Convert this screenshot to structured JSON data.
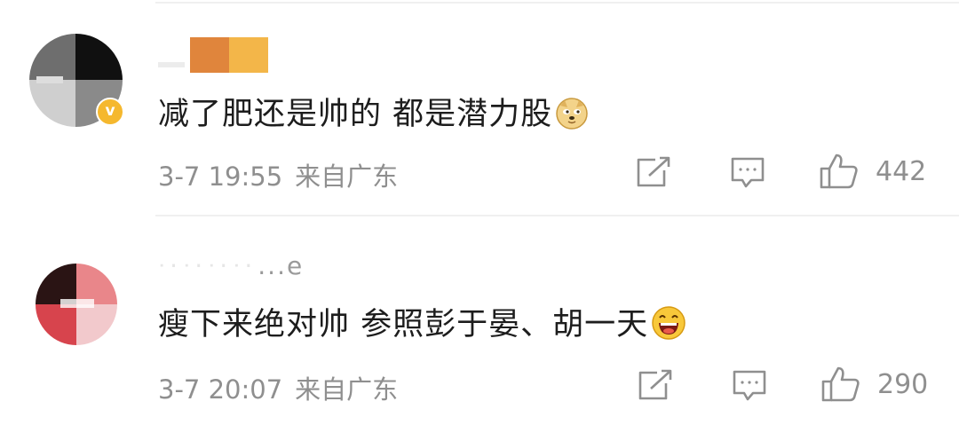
{
  "comments": [
    {
      "username": "",
      "text": "减了肥还是帅的 都是潜力股",
      "emoji": "doge-emoji",
      "date": "3-7 19:55",
      "location": "来自广东",
      "likes": "442",
      "verified": true
    },
    {
      "username": "...e",
      "text": "瘦下来绝对帅 参照彭于晏、胡一天",
      "emoji": "laughing-emoji",
      "date": "3-7 20:07",
      "location": "来自广东",
      "likes": "290",
      "verified": false
    }
  ],
  "colors": {
    "meta_text": "#8f8f8f",
    "comment_text": "#1d1d1d",
    "badge": "#f5b82e",
    "divider": "#f0f0f0"
  },
  "icons": [
    "share-icon",
    "reply-icon",
    "like-icon"
  ]
}
